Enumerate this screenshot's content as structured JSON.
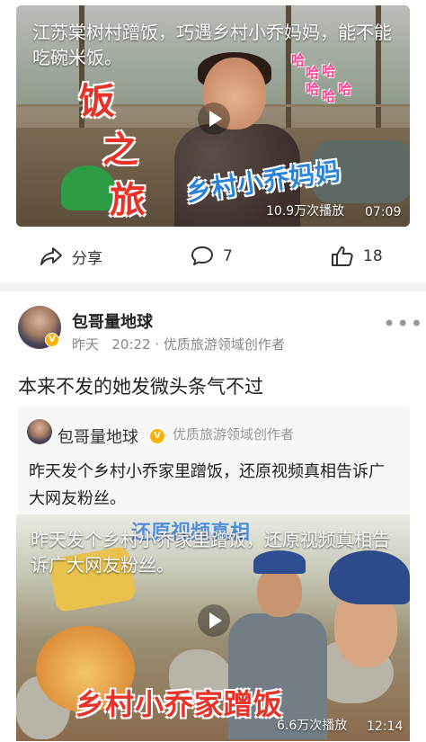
{
  "post1": {
    "video": {
      "overlay_title": "江苏棠树村蹭饭，巧遇乡村小乔妈妈，能不能吃碗米饭。",
      "side_text": [
        "饭",
        "之",
        "旅"
      ],
      "haha": [
        "哈",
        "哈",
        "哈",
        "哈",
        "哈",
        "哈"
      ],
      "sticker": "乡村小乔妈妈",
      "plays": "10.9万次播放",
      "duration": "07:09"
    },
    "actions": {
      "share_label": "分享",
      "comment_count": "7",
      "like_count": "18"
    }
  },
  "post2": {
    "author": "包哥量地球",
    "badge": "V",
    "time": "昨天",
    "clock": "20:22",
    "tag": "· 优质旅游领域创作者",
    "more": "•••",
    "text": "本来不发的她发微头条气不过",
    "quoted": {
      "author": "包哥量地球",
      "badge": "V",
      "tag": "优质旅游领域创作者",
      "text": "昨天发个乡村小乔家里蹭饭，还原视频真相告诉广大网友粉丝。",
      "video": {
        "top_banner": "还原视频真相",
        "overlay_title": "昨天发个乡村小乔家里蹭饭，还原视频真相告诉广大网友粉丝。",
        "bottom_banner": "乡村小乔家蹭饭",
        "plays": "6.6万次播放",
        "duration": "12:14"
      }
    }
  },
  "colors": {
    "accent_red": "#e8332a",
    "sticker_blue": "#2b83d8",
    "badge_gold": "#f6b400",
    "divider": "#f2f2f2"
  }
}
